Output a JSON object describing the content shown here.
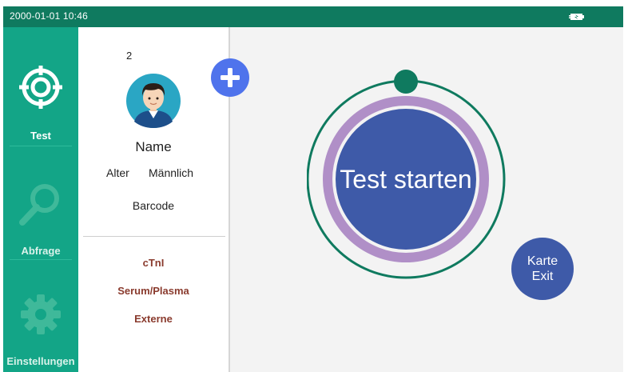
{
  "status_bar": {
    "datetime": "2000-01-01 10:46",
    "battery_icon": "charging-battery-icon"
  },
  "nav": {
    "items": [
      {
        "label": "Test",
        "icon": "crosshair-icon",
        "active": true
      },
      {
        "label": "Abfrage",
        "icon": "magnifier-icon",
        "active": false
      },
      {
        "label": "Einstellungen",
        "icon": "gear-icon",
        "active": false
      }
    ]
  },
  "patient": {
    "number": "2",
    "name": "Name",
    "age_label": "Alter",
    "gender": "Männlich",
    "barcode_label": "Barcode",
    "test_item": "cTnI",
    "sample_type": "Serum/Plasma",
    "mode": "Externe"
  },
  "actions": {
    "add_icon": "plus-icon",
    "start_label": "Test starten",
    "exit_line1": "Karte",
    "exit_line2": "Exit"
  },
  "colors": {
    "status_bar": "#0f7a5f",
    "nav_background": "#13a587",
    "button_blue": "#3e5aa8",
    "ring_purple": "#b08fc7",
    "ring_green": "#0f7a5f",
    "info_text": "#8a3b2e"
  }
}
